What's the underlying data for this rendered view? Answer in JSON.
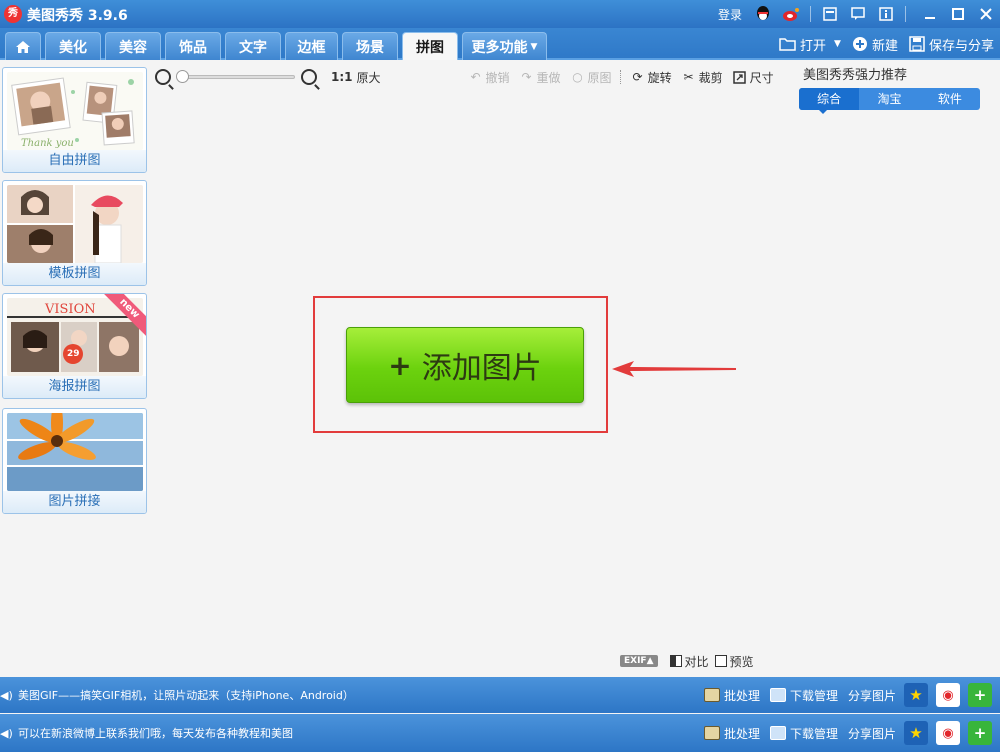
{
  "app": {
    "title": "美图秀秀 3.9.6",
    "logo_text": "秀"
  },
  "titlebar": {
    "login": "登录"
  },
  "tabs": [
    {
      "label": "⌂"
    },
    {
      "label": "美化"
    },
    {
      "label": "美容"
    },
    {
      "label": "饰品"
    },
    {
      "label": "文字"
    },
    {
      "label": "边框"
    },
    {
      "label": "场景"
    },
    {
      "label": "拼图",
      "active": true
    },
    {
      "label": "更多功能"
    }
  ],
  "toolbar_right": {
    "open": "打开",
    "new": "新建",
    "save_share": "保存与分享"
  },
  "templates": [
    {
      "label": "自由拼图"
    },
    {
      "label": "模板拼图"
    },
    {
      "label": "海报拼图",
      "badge": "new",
      "poster_text": "VISION"
    },
    {
      "label": "图片拼接"
    }
  ],
  "edit_toolbar": {
    "ratio": "1:1",
    "original_size": "原大",
    "undo": "撤销",
    "redo": "重做",
    "original": "原图",
    "rotate": "旋转",
    "crop": "裁剪",
    "resize": "尺寸"
  },
  "recommend": {
    "title": "美图秀秀强力推荐",
    "tabs": [
      "综合",
      "淘宝",
      "软件"
    ],
    "active_index": 0
  },
  "add_button": {
    "plus": "+",
    "label": "添加图片"
  },
  "mini_tools": {
    "exif": "EXIF▲",
    "compare": "对比",
    "preview": "预览"
  },
  "status1": {
    "text": "美图GIF——搞笑GIF相机，让照片动起来（支持iPhone、Android）",
    "batch": "批处理",
    "download": "下载管理",
    "share": "分享图片"
  },
  "status2": {
    "text": "可以在新浪微博上联系我们哦，每天发布各种教程和美图",
    "batch": "批处理",
    "download": "下载管理",
    "share": "分享图片"
  },
  "colors": {
    "accent": "#2c73c4",
    "highlight": "#e23b3b",
    "add_green": "#6cd20e"
  }
}
